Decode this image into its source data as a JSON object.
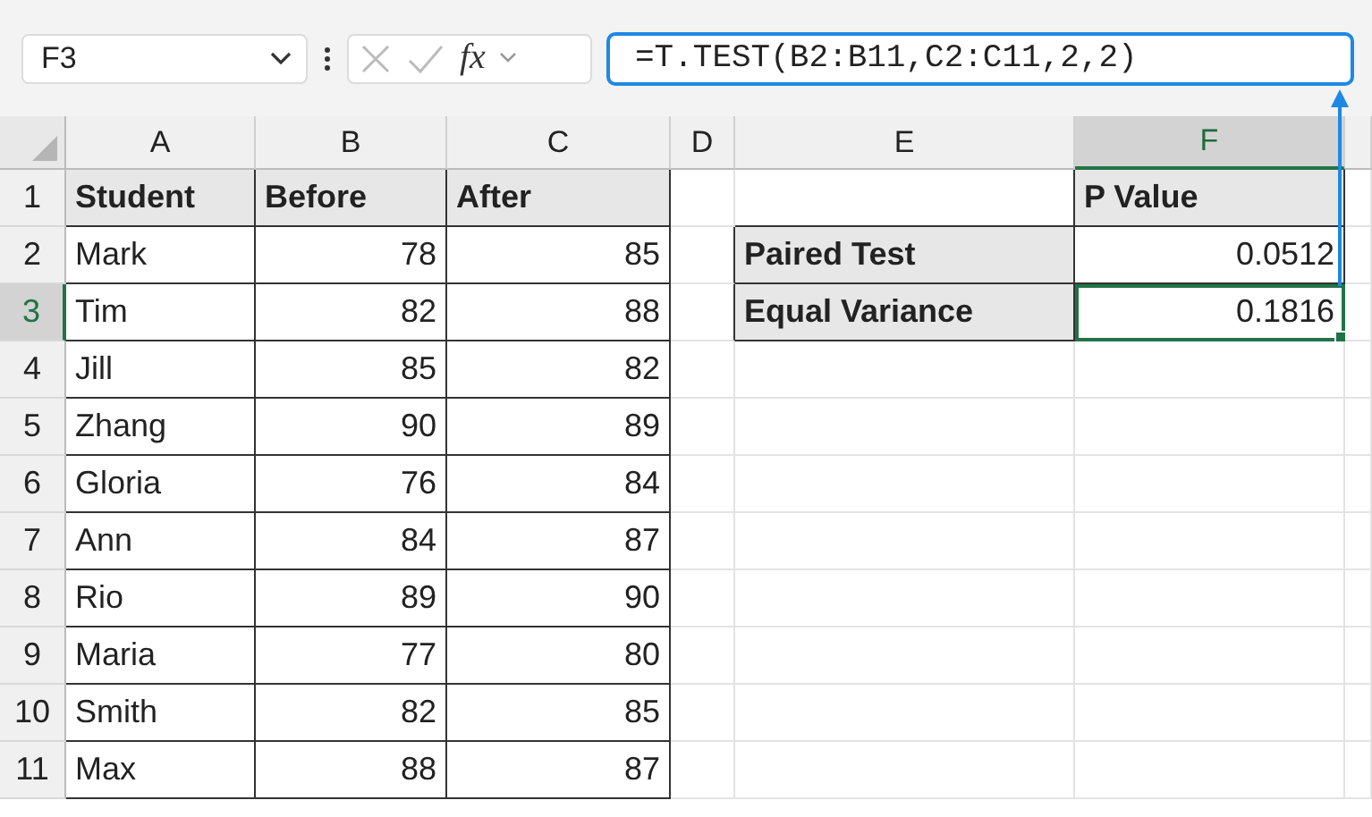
{
  "formula_bar": {
    "name_box": "F3",
    "fx_label": "fx",
    "formula": "=T.TEST(B2:B11,C2:C11,2,2)"
  },
  "sheet": {
    "columns": [
      {
        "label": "A",
        "selected": false
      },
      {
        "label": "B",
        "selected": false
      },
      {
        "label": "C",
        "selected": false
      },
      {
        "label": "D",
        "selected": false
      },
      {
        "label": "E",
        "selected": false
      },
      {
        "label": "F",
        "selected": true
      }
    ],
    "header_row": {
      "number": "1",
      "selected": false,
      "cells": [
        "Student",
        "Before",
        "After"
      ],
      "result_heading": "P Value"
    },
    "rows": [
      {
        "number": "2",
        "selected": false,
        "student": "Mark",
        "before": "78",
        "after": "85",
        "result_label": "Paired Test",
        "result_value": "0.0512",
        "result_selected": false
      },
      {
        "number": "3",
        "selected": true,
        "student": "Tim",
        "before": "82",
        "after": "88",
        "result_label": "Equal Variance",
        "result_value": "0.1816",
        "result_selected": true
      },
      {
        "number": "4",
        "selected": false,
        "student": "Jill",
        "before": "85",
        "after": "82"
      },
      {
        "number": "5",
        "selected": false,
        "student": "Zhang",
        "before": "90",
        "after": "89"
      },
      {
        "number": "6",
        "selected": false,
        "student": "Gloria",
        "before": "76",
        "after": "84"
      },
      {
        "number": "7",
        "selected": false,
        "student": "Ann",
        "before": "84",
        "after": "87"
      },
      {
        "number": "8",
        "selected": false,
        "student": "Rio",
        "before": "89",
        "after": "90"
      },
      {
        "number": "9",
        "selected": false,
        "student": "Maria",
        "before": "77",
        "after": "80"
      },
      {
        "number": "10",
        "selected": false,
        "student": "Smith",
        "before": "82",
        "after": "85"
      },
      {
        "number": "11",
        "selected": false,
        "student": "Max",
        "before": "88",
        "after": "87"
      }
    ]
  }
}
